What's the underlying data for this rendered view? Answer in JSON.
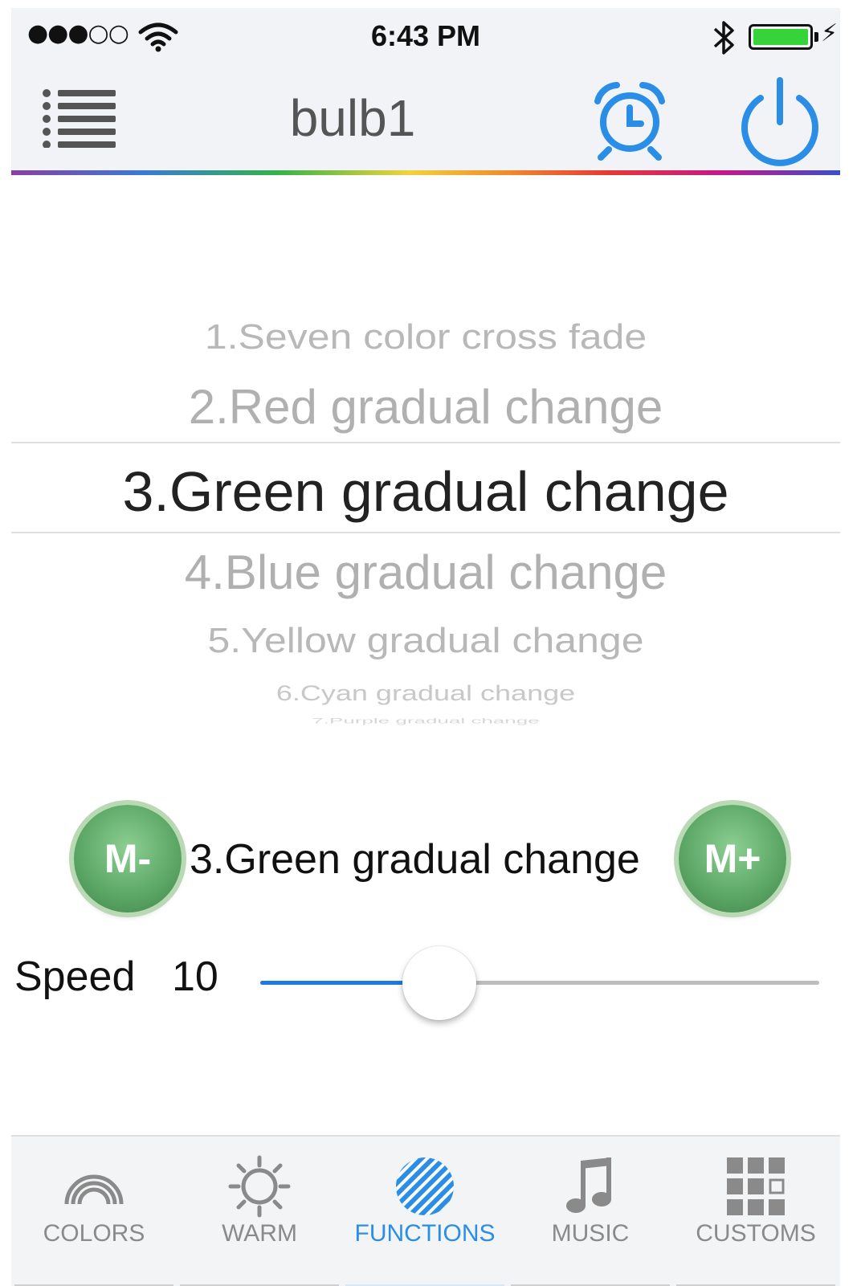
{
  "status_bar": {
    "signal": "●●●○○",
    "time": "6:43 PM",
    "bluetooth": "bluetooth-icon",
    "battery_level": 1.0,
    "battery_color": "#36d33a"
  },
  "nav": {
    "title": "bulb1",
    "menu_icon": "list-icon",
    "alarm_icon": "alarm-clock-icon",
    "power_icon": "power-icon",
    "accent_color": "#2b8ee6"
  },
  "picker": {
    "items": [
      "1.Seven color cross fade",
      "2.Red  gradual change",
      "3.Green gradual change",
      "4.Blue gradual change",
      "5.Yellow gradual change",
      "6.Cyan gradual change",
      "7.Purple gradual change"
    ],
    "selected_index": 2
  },
  "mode": {
    "minus_label": "M-",
    "plus_label": "M+",
    "current": "3.Green gradual change",
    "button_color": "#5ea968"
  },
  "speed": {
    "label": "Speed",
    "value": "10",
    "slider_fraction": 0.32,
    "fill_color": "#1f7ae0"
  },
  "tabs": [
    {
      "label": "COLORS",
      "icon": "rainbow-icon",
      "active": false
    },
    {
      "label": "WARM",
      "icon": "sun-icon",
      "active": false
    },
    {
      "label": "FUNCTIONS",
      "icon": "striped-circle-icon",
      "active": true
    },
    {
      "label": "MUSIC",
      "icon": "music-note-icon",
      "active": false
    },
    {
      "label": "CUSTOMS",
      "icon": "grid-icon",
      "active": false
    }
  ]
}
